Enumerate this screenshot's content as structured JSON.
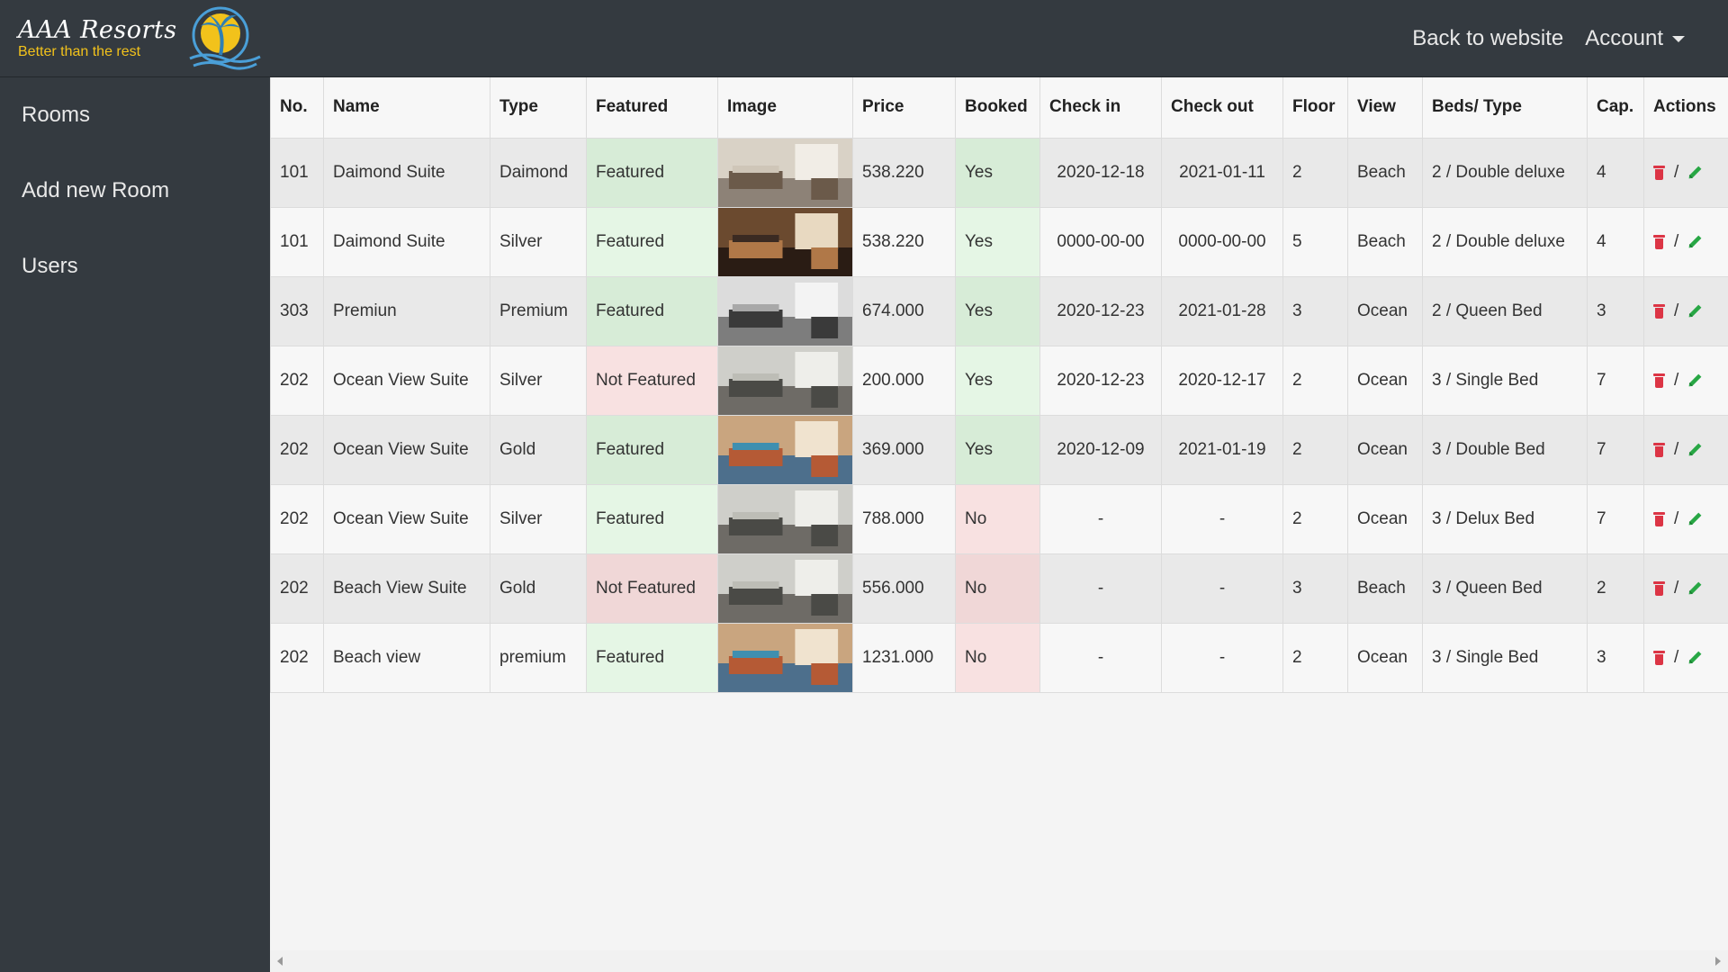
{
  "brand": {
    "title": "AAA Resorts",
    "subtitle": "Better than the rest"
  },
  "nav": {
    "back_label": "Back to website",
    "account_label": "Account"
  },
  "sidebar": {
    "items": [
      {
        "label": "Rooms"
      },
      {
        "label": "Add new Room"
      },
      {
        "label": "Users"
      }
    ]
  },
  "table": {
    "headers": [
      "No.",
      "Name",
      "Type",
      "Featured",
      "Image",
      "Price",
      "Booked",
      "Check in",
      "Check out",
      "Floor",
      "View",
      "Beds/ Type",
      "Cap.",
      "Actions"
    ],
    "action_separator": "/",
    "rows": [
      {
        "no": "101",
        "name": "Daimond Suite",
        "type": "Daimond",
        "featured": "Featured",
        "image": "room-photo-bedroom-window",
        "price": "538.220",
        "booked": "Yes",
        "check_in": "2020-12-18",
        "check_out": "2021-01-11",
        "floor": "2",
        "view": "Beach",
        "beds": "2 / Double deluxe",
        "cap": "4"
      },
      {
        "no": "101",
        "name": "Daimond Suite",
        "type": "Silver",
        "featured": "Featured",
        "image": "room-photo-bedroom-night",
        "price": "538.220",
        "booked": "Yes",
        "check_in": "0000-00-00",
        "check_out": "0000-00-00",
        "floor": "5",
        "view": "Beach",
        "beds": "2 / Double deluxe",
        "cap": "4"
      },
      {
        "no": "303",
        "name": "Premiun",
        "type": "Premium",
        "featured": "Featured",
        "image": "room-photo-living-room",
        "price": "674.000",
        "booked": "Yes",
        "check_in": "2020-12-23",
        "check_out": "2021-01-28",
        "floor": "3",
        "view": "Ocean",
        "beds": "2 / Queen Bed",
        "cap": "3"
      },
      {
        "no": "202",
        "name": "Ocean View Suite",
        "type": "Silver",
        "featured": "Not Featured",
        "image": "room-photo-bathroom",
        "price": "200.000",
        "booked": "Yes",
        "check_in": "2020-12-23",
        "check_out": "2020-12-17",
        "floor": "2",
        "view": "Ocean",
        "beds": "3 / Single Bed",
        "cap": "7"
      },
      {
        "no": "202",
        "name": "Ocean View Suite",
        "type": "Gold",
        "featured": "Featured",
        "image": "room-photo-lounge",
        "price": "369.000",
        "booked": "Yes",
        "check_in": "2020-12-09",
        "check_out": "2021-01-19",
        "floor": "2",
        "view": "Ocean",
        "beds": "3 / Double Bed",
        "cap": "7"
      },
      {
        "no": "202",
        "name": "Ocean View Suite",
        "type": "Silver",
        "featured": "Featured",
        "image": "room-photo-bathroom",
        "price": "788.000",
        "booked": "No",
        "check_in": "-",
        "check_out": "-",
        "floor": "2",
        "view": "Ocean",
        "beds": "3 / Delux Bed",
        "cap": "7"
      },
      {
        "no": "202",
        "name": "Beach View Suite",
        "type": "Gold",
        "featured": "Not Featured",
        "image": "room-photo-bathroom",
        "price": "556.000",
        "booked": "No",
        "check_in": "-",
        "check_out": "-",
        "floor": "3",
        "view": "Beach",
        "beds": "3 / Queen Bed",
        "cap": "2"
      },
      {
        "no": "202",
        "name": "Beach view",
        "type": "premium",
        "featured": "Featured",
        "image": "room-photo-lounge",
        "price": "1231.000",
        "booked": "No",
        "check_in": "-",
        "check_out": "-",
        "floor": "2",
        "view": "Ocean",
        "beds": "3 / Single Bed",
        "cap": "3"
      }
    ]
  },
  "colors": {
    "navbar_bg": "#343a40",
    "featured_bg": "#e5f6e5",
    "not_featured_bg": "#f8e1e1",
    "delete_icon": "#dc3545",
    "edit_icon": "#28a745",
    "brand_accent": "#f2c21b"
  }
}
